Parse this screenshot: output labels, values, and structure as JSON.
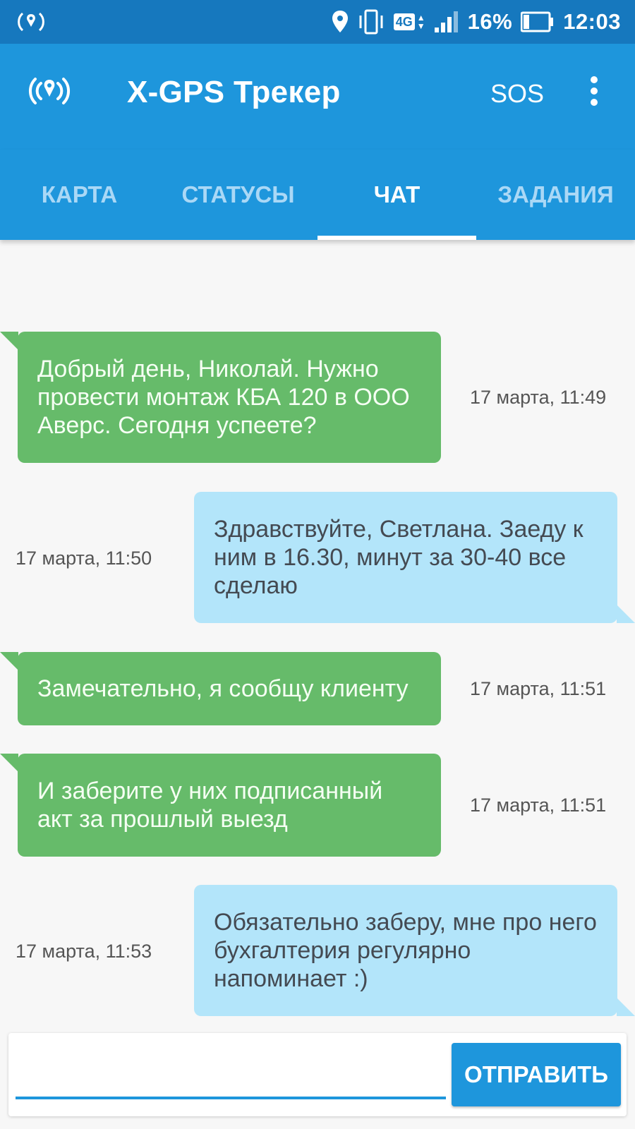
{
  "status_bar": {
    "battery": "16%",
    "time": "12:03",
    "network": "4G"
  },
  "app_bar": {
    "title": "X-GPS Трекер",
    "sos_label": "SOS"
  },
  "tabs": [
    {
      "label": "КАРТА"
    },
    {
      "label": "СТАТУСЫ"
    },
    {
      "label": "ЧАТ"
    },
    {
      "label": "ЗАДАНИЯ"
    }
  ],
  "active_tab": "ЧАТ",
  "messages": [
    {
      "direction": "in",
      "text": "Добрый день, Николай. Нужно провести монтаж КБА 120 в ООО Аверс. Сегодня успеете?",
      "time": "17 марта, 11:49"
    },
    {
      "direction": "out",
      "text": "Здравствуйте, Светлана. Заеду к ним в 16.30, минут за 30-40 все сделаю",
      "time": "17 марта, 11:50"
    },
    {
      "direction": "in",
      "text": "Замечательно, я сообщу клиенту",
      "time": "17 марта, 11:51"
    },
    {
      "direction": "in",
      "text": "И заберите у них подписанный акт за прошлый выезд",
      "time": "17 марта, 11:51"
    },
    {
      "direction": "out",
      "text": "Обязательно заберу, мне про него бухгалтерия регулярно напоминает :)",
      "time": "17 марта, 11:53"
    }
  ],
  "composer": {
    "value": "",
    "send_label": "ОТПРАВИТЬ"
  },
  "colors": {
    "status_bar": "#1678be",
    "app_bar": "#1e96dc",
    "incoming_bubble": "#66bb6a",
    "outgoing_bubble": "#b3e5fa"
  }
}
